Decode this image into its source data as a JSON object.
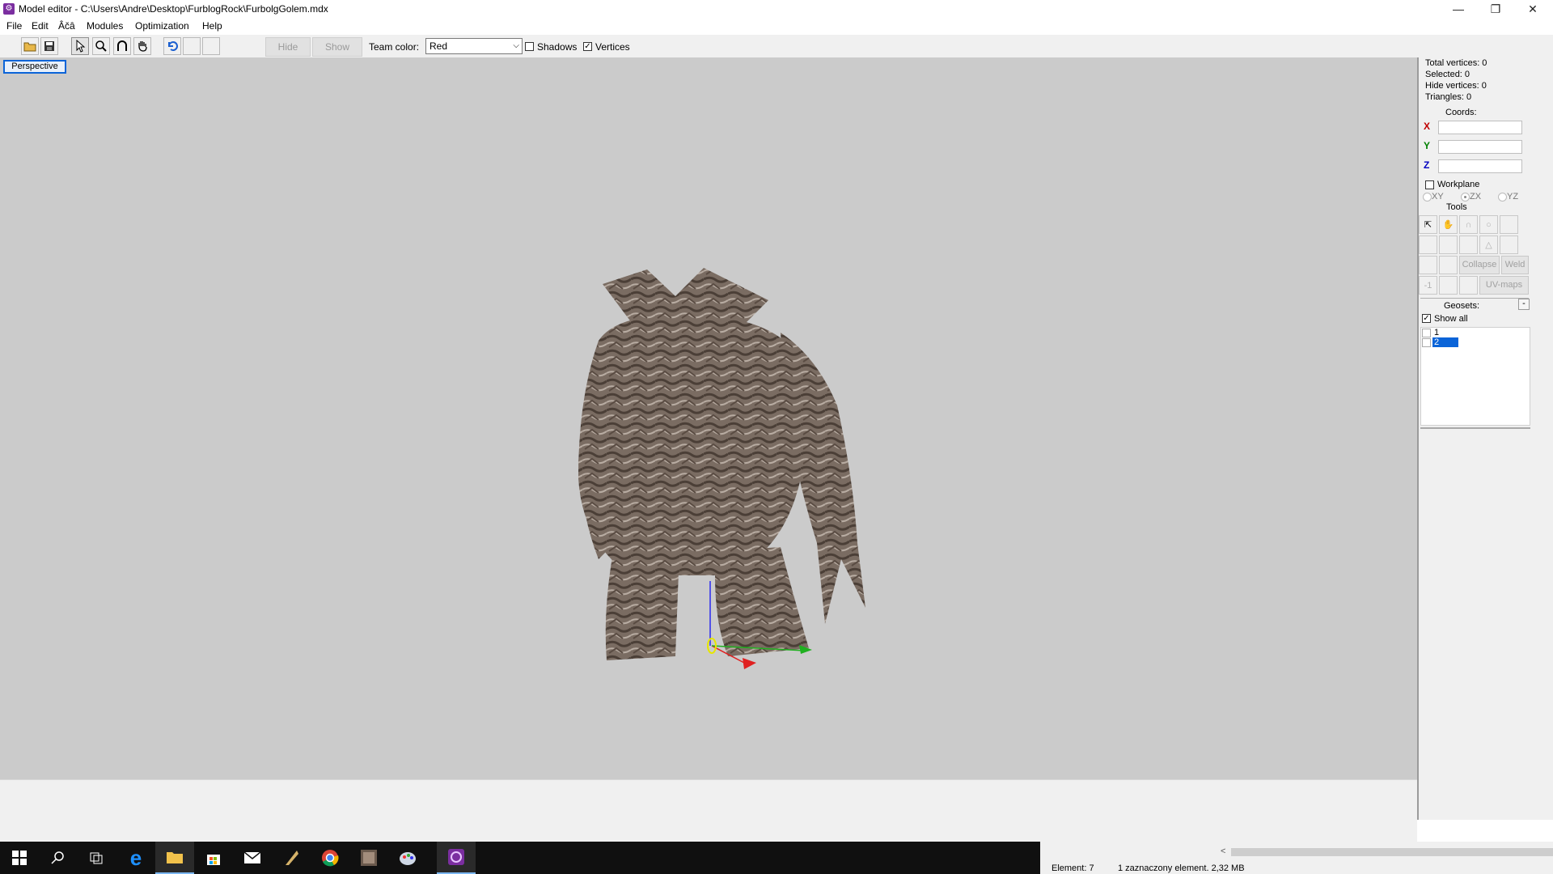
{
  "window": {
    "title": "Model editor - C:\\Users\\Andre\\Desktop\\FurblogRock\\FurbolgGolem.mdx",
    "minimize": "—",
    "maximize": "❐",
    "close": "✕"
  },
  "menu": [
    "File",
    "Edit",
    "Âčâ",
    "Modules",
    "Optimization",
    "Help"
  ],
  "toolbar": {
    "hide_label": "Hide",
    "show_label": "Show",
    "team_color_label": "Team color:",
    "team_color_value": "Red",
    "shadows_label": "Shadows",
    "shadows_checked": false,
    "vertices_label": "Vertices",
    "vertices_checked": true
  },
  "viewport": {
    "view_mode": "Perspective",
    "background": "#cbcbcb"
  },
  "panel": {
    "total_vertices": "Total vertices: 0",
    "selected": "Selected: 0",
    "hide_vertices": "Hide vertices: 0",
    "triangles": "Triangles: 0",
    "coords_label": "Coords:",
    "x_label": "X",
    "y_label": "Y",
    "z_label": "Z",
    "x_color": "#c00000",
    "y_color": "#008000",
    "z_color": "#0000c0",
    "workplane_label": "Workplane",
    "plane_xy": "XY",
    "plane_zx": "ZX",
    "plane_yz": "YZ",
    "tools_label": "Tools",
    "collapse_label": "Collapse",
    "weld_label": "Weld",
    "minus_one": "-1",
    "uvmaps_label": "UV-maps",
    "geosets_label": "Geosets:",
    "geosets_collapse": "-",
    "show_all_label": "Show all",
    "show_all_checked": true,
    "geosets": [
      {
        "label": "1",
        "selected": false
      },
      {
        "label": "2",
        "selected": true
      }
    ]
  },
  "statusbar": {
    "element": "Element: 7",
    "selection_info": "1 zaznaczony element. 2,32 MB",
    "scroll_left": "<"
  }
}
